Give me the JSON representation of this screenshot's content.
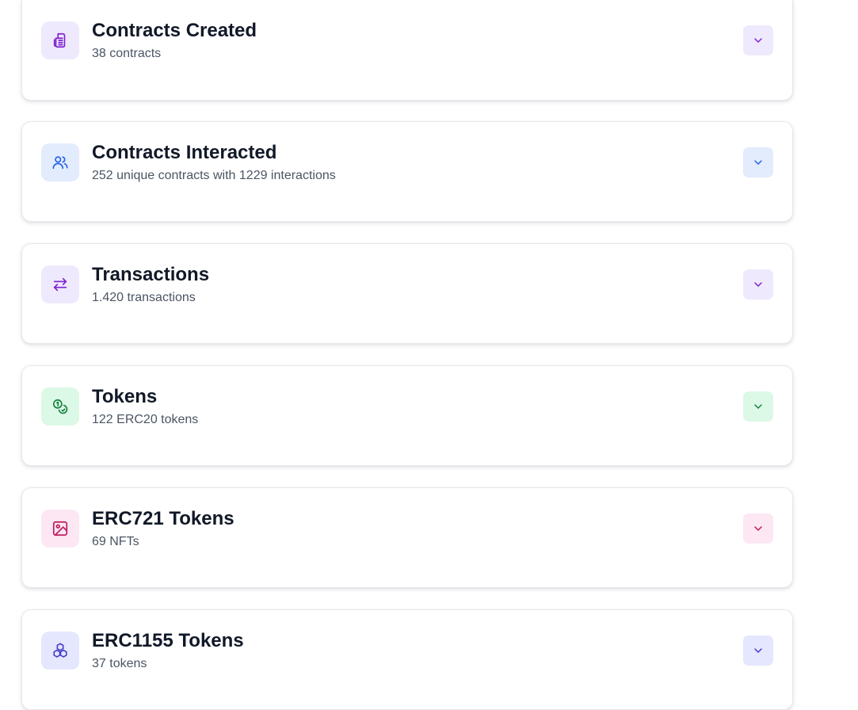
{
  "sections": [
    {
      "title": "Contracts Created",
      "subtitle": "38 contracts",
      "icon": "document-icon",
      "accent": "#7e22ce",
      "tint": "#efe9fd"
    },
    {
      "title": "Contracts Interacted",
      "subtitle": "252 unique contracts with 1229 interactions",
      "icon": "users-icon",
      "accent": "#2563eb",
      "tint": "#e2ecfd"
    },
    {
      "title": "Transactions",
      "subtitle": "1.420 transactions",
      "icon": "arrows-swap-icon",
      "accent": "#7e22ce",
      "tint": "#efe9fd"
    },
    {
      "title": "Tokens",
      "subtitle": "122 ERC20 tokens",
      "icon": "coins-icon",
      "accent": "#15803d",
      "tint": "#dcf8e6"
    },
    {
      "title": "ERC721 Tokens",
      "subtitle": "69 NFTs",
      "icon": "image-icon",
      "accent": "#be185d",
      "tint": "#fce7f3"
    },
    {
      "title": "ERC1155 Tokens",
      "subtitle": "37 tokens",
      "icon": "cubes-icon",
      "accent": "#4338ca",
      "tint": "#e4e7fd"
    }
  ]
}
